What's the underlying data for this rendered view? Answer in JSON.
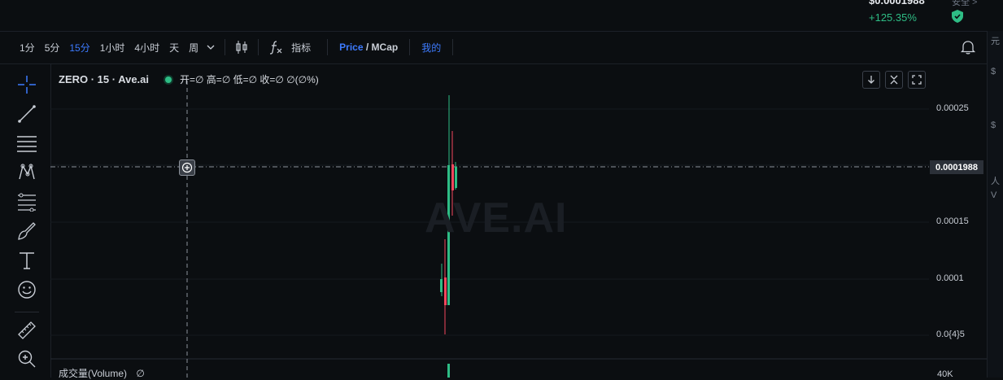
{
  "header": {
    "price": "$0.0001988",
    "change": "+125.35%",
    "extra_label": "安全 >"
  },
  "toolbar": {
    "intervals": [
      "1分",
      "5分",
      "15分",
      "1小时",
      "4小时",
      "天",
      "周"
    ],
    "active_interval": "15分",
    "indicators_label": "指标",
    "price_label": "Price",
    "slash": "/",
    "mcap_label": "MCap",
    "mine_label": "我的"
  },
  "legend": {
    "symbol": "ZERO · 15 · Ave.ai",
    "ohlc": "开=∅ 高=∅ 低=∅ 收=∅ ∅(∅%)"
  },
  "y_axis": {
    "ticks": [
      "0.00025",
      "0.00015",
      "0.0001",
      "0.0{4}5"
    ],
    "current_price": "0.0001988"
  },
  "watermark": "AVE.AI",
  "volume": {
    "label": "成交量(Volume)",
    "value": "∅",
    "axis_tick": "40K"
  },
  "right_strip": [
    "元",
    "$",
    "$",
    "人",
    "V"
  ],
  "colors": {
    "background": "#0b0e11",
    "up": "#2ebd85",
    "down": "#f6465d",
    "accent": "#3d7bff"
  }
}
